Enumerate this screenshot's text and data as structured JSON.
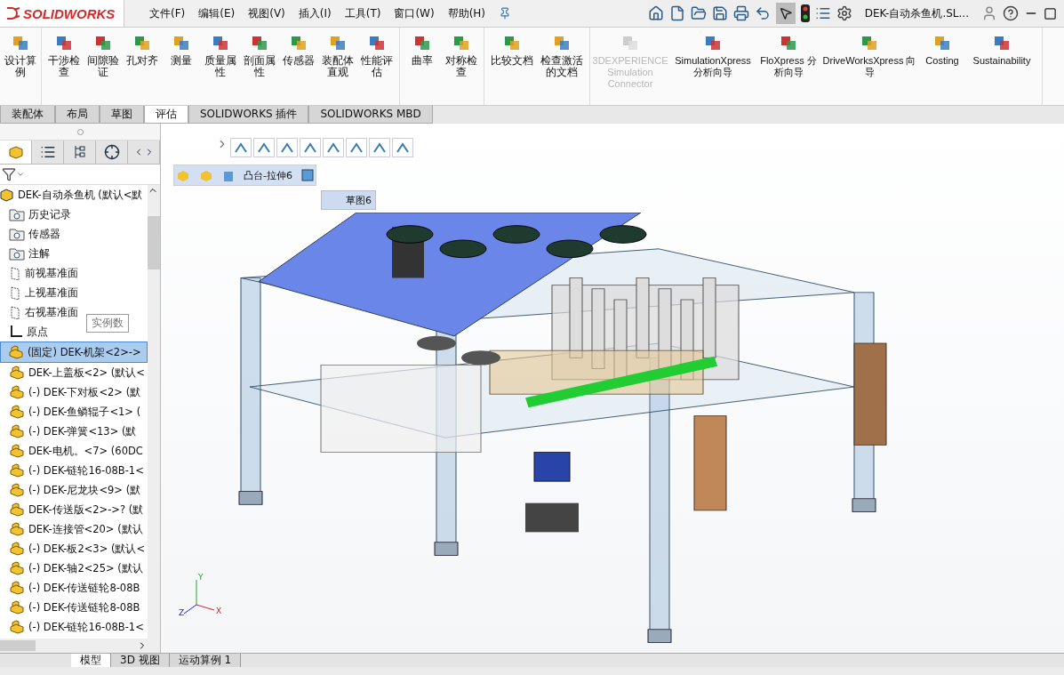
{
  "app": {
    "logo": "SOLIDWORKS",
    "menu": [
      "文件(F)",
      "编辑(E)",
      "视图(V)",
      "插入(I)",
      "工具(T)",
      "窗口(W)",
      "帮助(H)"
    ],
    "document_title": "DEK-自动杀鱼机.SL..."
  },
  "ribbon": {
    "groups": [
      [
        {
          "label": "设计算例",
          "disabled": false
        }
      ],
      [
        {
          "label": "干涉检查",
          "disabled": false
        },
        {
          "label": "间隙验证",
          "disabled": false
        },
        {
          "label": "孔对齐",
          "disabled": false
        },
        {
          "label": "测量",
          "disabled": false
        },
        {
          "label": "质量属性",
          "disabled": false
        },
        {
          "label": "剖面属性",
          "disabled": false
        },
        {
          "label": "传感器",
          "disabled": false
        },
        {
          "label": "装配体直观",
          "disabled": false
        },
        {
          "label": "性能评估",
          "disabled": false
        }
      ],
      [
        {
          "label": "曲率",
          "disabled": false
        },
        {
          "label": "对称检查",
          "disabled": false
        }
      ],
      [
        {
          "label": "比较文档",
          "disabled": false
        },
        {
          "label": "检查激活的文档",
          "disabled": false
        }
      ],
      [
        {
          "label": "3DEXPERIENCE Simulation Connector",
          "disabled": true
        },
        {
          "label": "SimulationXpress 分析向导",
          "disabled": false
        },
        {
          "label": "FloXpress 分析向导",
          "disabled": false
        },
        {
          "label": "DriveWorksXpress 向导",
          "disabled": false
        },
        {
          "label": "Costing",
          "disabled": false
        },
        {
          "label": "Sustainability",
          "disabled": false
        }
      ]
    ]
  },
  "tabs": [
    {
      "label": "装配体",
      "selected": false
    },
    {
      "label": "布局",
      "selected": false
    },
    {
      "label": "草图",
      "selected": false
    },
    {
      "label": "评估",
      "selected": true
    },
    {
      "label": "SOLIDWORKS 插件",
      "selected": false
    },
    {
      "label": "SOLIDWORKS MBD",
      "selected": false
    }
  ],
  "tree": {
    "root": "DEK-自动杀鱼机 (默认<默",
    "items": [
      {
        "kind": "folder",
        "label": "历史记录",
        "selected": false
      },
      {
        "kind": "sensor",
        "label": "传感器",
        "selected": false
      },
      {
        "kind": "annotation",
        "label": "注解",
        "selected": false
      },
      {
        "kind": "plane",
        "label": "前视基准面",
        "selected": false
      },
      {
        "kind": "plane",
        "label": "上视基准面",
        "selected": false
      },
      {
        "kind": "plane",
        "label": "右视基准面",
        "selected": false
      },
      {
        "kind": "origin",
        "label": "原点",
        "selected": false
      },
      {
        "kind": "part",
        "label": "(固定) DEK-机架<2>->",
        "selected": true
      },
      {
        "kind": "part",
        "label": "DEK-上盖板<2> (默认<",
        "selected": false
      },
      {
        "kind": "part",
        "label": "(-) DEK-下对板<2> (默",
        "selected": false
      },
      {
        "kind": "part",
        "label": "(-) DEK-鱼鳞辊子<1> (",
        "selected": false
      },
      {
        "kind": "part",
        "label": "(-) DEK-弹簧<13> (默",
        "selected": false
      },
      {
        "kind": "part",
        "label": "DEK-电机。<7> (60DC",
        "selected": false
      },
      {
        "kind": "part",
        "label": "(-) DEK-链轮16-08B-1<",
        "selected": false
      },
      {
        "kind": "part",
        "label": "(-) DEK-尼龙块<9> (默",
        "selected": false
      },
      {
        "kind": "part",
        "label": "DEK-传送版<2>->? (默",
        "selected": false
      },
      {
        "kind": "part",
        "label": "DEK-连接管<20> (默认",
        "selected": false
      },
      {
        "kind": "part",
        "label": "(-) DEK-板2<3> (默认<",
        "selected": false
      },
      {
        "kind": "part",
        "label": "(-) DEK-轴2<25> (默认",
        "selected": false
      },
      {
        "kind": "part",
        "label": "(-) DEK-传送链轮8-08B",
        "selected": false
      },
      {
        "kind": "part",
        "label": "(-) DEK-传送链轮8-08B",
        "selected": false
      },
      {
        "kind": "part",
        "label": "(-) DEK-链轮16-08B-1<",
        "selected": false
      }
    ],
    "tooltip": "实例数"
  },
  "breadcrumb": {
    "feature": "凸台-拉伸6",
    "sketch": "草图6"
  },
  "triad": [
    "Y",
    "Z",
    "X"
  ],
  "bottom_tabs": [
    {
      "label": "模型",
      "selected": true
    },
    {
      "label": "3D 视图",
      "selected": false
    },
    {
      "label": "运动算例 1",
      "selected": false
    }
  ]
}
